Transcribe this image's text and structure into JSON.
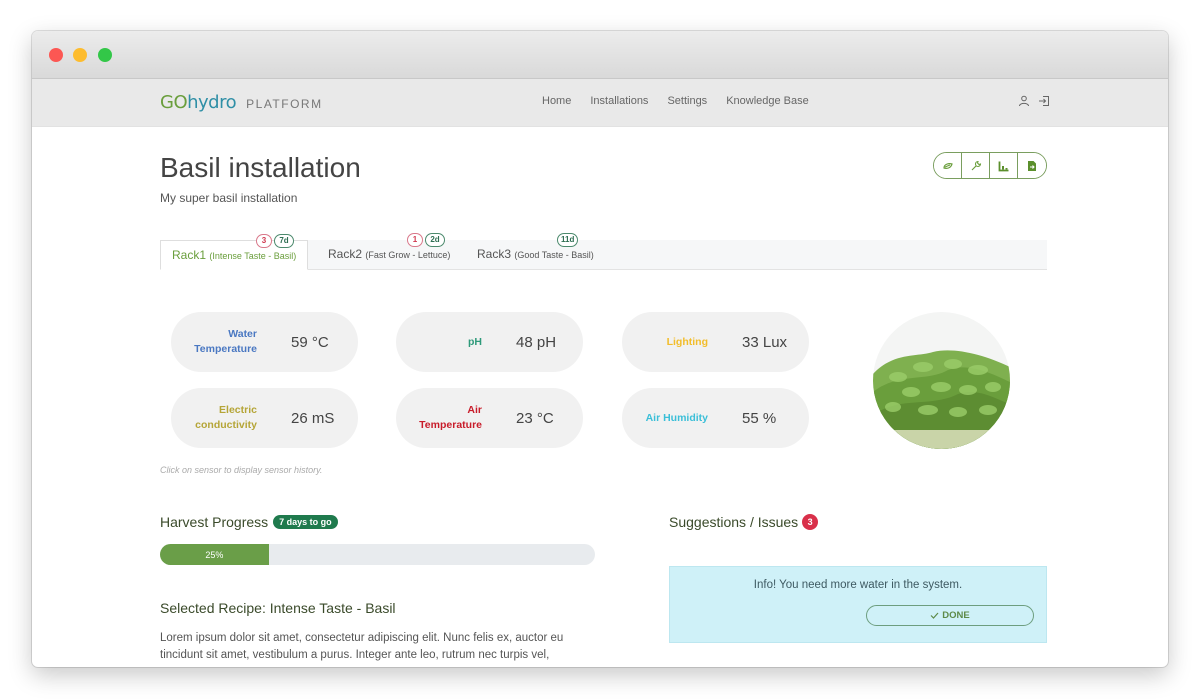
{
  "navbar": {
    "brand_go": "GO",
    "brand_hydro": "hydro",
    "brand_platform": "PLATFORM",
    "links": [
      "Home",
      "Installations",
      "Settings",
      "Knowledge Base"
    ],
    "icons": [
      "user-icon",
      "sign-out-icon"
    ]
  },
  "page": {
    "title": "Basil installation",
    "subtitle": "My super basil installation",
    "actions": [
      "seedling-icon",
      "wrench-icon",
      "chart-icon",
      "export-document-icon"
    ]
  },
  "tabs": [
    {
      "name": "Rack1",
      "sub": "(Intense Taste - Basil)",
      "issues": "3",
      "days": "7d",
      "active": true
    },
    {
      "name": "Rack2",
      "sub": "(Fast Grow - Lettuce)",
      "issues": "1",
      "days": "2d",
      "active": false
    },
    {
      "name": "Rack3",
      "sub": "(Good Taste - Basil)",
      "issues": null,
      "days": "11d",
      "active": false
    }
  ],
  "sensors": [
    {
      "label": "Water Temperature",
      "value": "59 °C",
      "color": "#4a78c2"
    },
    {
      "label": "pH",
      "value": "48 pH",
      "color": "#2e9a7a"
    },
    {
      "label": "Lighting",
      "value": "33 Lux",
      "color": "#f2bd2a"
    },
    {
      "label": "Electric conductivity",
      "value": "26 mS",
      "color": "#b5a537"
    },
    {
      "label": "Air Temperature",
      "value": "23 °C",
      "color": "#c81c2a"
    },
    {
      "label": "Air Humidity",
      "value": "55 %",
      "color": "#3bbfd8"
    }
  ],
  "sensor_hint": "Click on sensor to display sensor history.",
  "harvest": {
    "title": "Harvest Progress",
    "badge": "7 days to go",
    "progress_percent": 25,
    "progress_label": "25%"
  },
  "recipe": {
    "title": "Selected Recipe: Intense Taste - Basil",
    "text": "Lorem ipsum dolor sit amet, consectetur adipiscing elit. Nunc felis ex, auctor eu tincidunt sit amet, vestibulum a purus. Integer ante leo, rutrum nec turpis vel,"
  },
  "issues": {
    "title": "Suggestions / Issues",
    "count": "3",
    "alert_text": "Info! You need more water in the system.",
    "done_label": "DONE"
  },
  "colors": {
    "brand_green": "#6a9e3c",
    "brand_blue": "#2f8fa6",
    "progress": "#6a9e48",
    "alert_bg": "#cff1f8",
    "danger": "#d9304a"
  }
}
